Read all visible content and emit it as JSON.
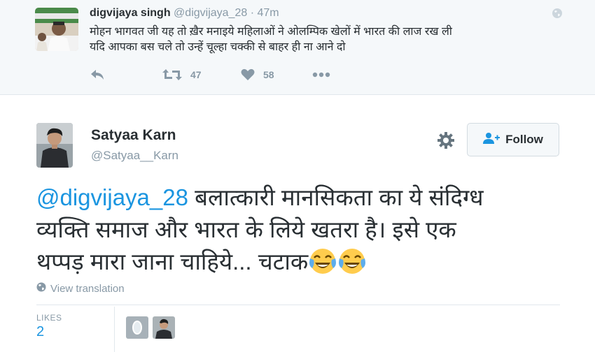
{
  "parent_tweet": {
    "name": "digvijaya singh",
    "handle": "@digvijaya_28",
    "separator": "·",
    "time": "47m",
    "text_lines": [
      "मोहन भागवत जी यह तो ख़ैर मनाइये महिलाओं ने ओलम्पिक खेलों में भारत की लाज रख ली",
      "यदि आपका बस चले तो उन्हें चूल्हा चक्की से बाहर ही ना आने दो"
    ],
    "retweet_count": "47",
    "like_count": "58"
  },
  "main_tweet": {
    "name": "Satyaa Karn",
    "handle": "@Satyaa__Karn",
    "follow_label": "Follow",
    "mention": "@digvijaya_28",
    "line1_rest": " बलात्कारी मानसिकता का ये संदिग्ध",
    "line2": "व्यक्ति समाज और भारत के लिये खतरा है। इसे एक",
    "line3": "थप्पड़ मारा जाना चाहिये... चटाक",
    "emoji": [
      "face-with-tears-of-joy",
      "face-with-tears-of-joy"
    ],
    "view_translation": "View translation",
    "likes_label": "LIKES",
    "likes_count": "2"
  },
  "icons": {
    "reply": "reply-icon",
    "retweet": "retweet-icon",
    "like": "heart-icon",
    "more": "more-icon",
    "globe": "globe-icon",
    "gear": "gear-icon",
    "follow": "follow-user-icon"
  },
  "colors": {
    "accent": "#1b95e0",
    "muted": "#8899a6",
    "text": "#292f33",
    "parent_bg": "#f5f8fa"
  }
}
